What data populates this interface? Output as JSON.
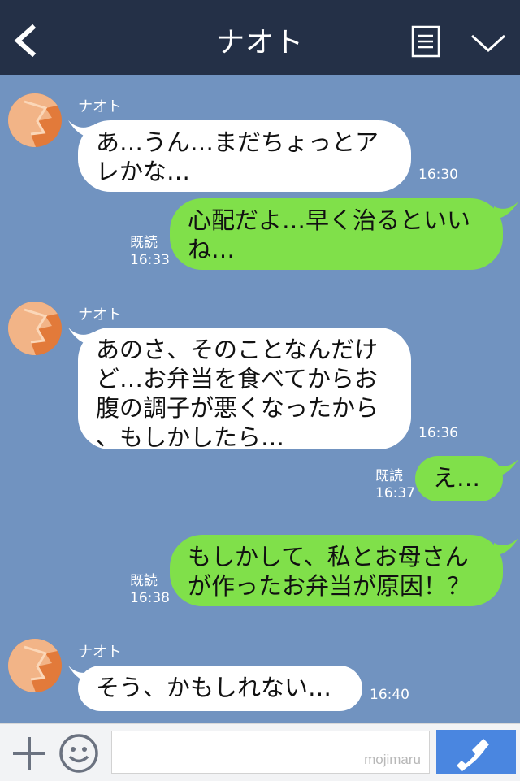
{
  "header": {
    "title": "ナオト"
  },
  "messages": [
    {
      "side": "in",
      "sender": "ナオト",
      "lines": [
        "あ…うん…まだちょっとア",
        "レかな…"
      ],
      "time": "16:30"
    },
    {
      "side": "out",
      "read": "既読",
      "lines": [
        "心配だよ…早く治るといい",
        "ね…"
      ],
      "time": "16:33"
    },
    {
      "side": "in",
      "sender": "ナオト",
      "lines": [
        "あのさ、そのことなんだけ",
        "ど…お弁当を食べてからお",
        "腹の調子が悪くなったから",
        "、もしかしたら…"
      ],
      "time": "16:36"
    },
    {
      "side": "out",
      "read": "既読",
      "lines": [
        "え…"
      ],
      "time": "16:37"
    },
    {
      "side": "out",
      "read": "既読",
      "lines": [
        "もしかして、私とお母さん",
        "が作ったお弁当が原因！？"
      ],
      "time": "16:38"
    },
    {
      "side": "in",
      "sender": "ナオト",
      "lines": [
        "そう、かもしれない…"
      ],
      "time": "16:40"
    }
  ],
  "footer": {
    "watermark": "mojimaru"
  },
  "colors": {
    "header_bg": "#243047",
    "chat_bg": "#7193c0",
    "incoming_bubble": "#ffffff",
    "outgoing_bubble": "#80e04a",
    "call_button": "#4a86e0"
  },
  "icons": {
    "back": "chevron-left-icon",
    "memo": "note-list-icon",
    "menu": "chevron-down-icon",
    "plus": "plus-icon",
    "emoji": "smiley-icon",
    "call": "phone-icon"
  }
}
